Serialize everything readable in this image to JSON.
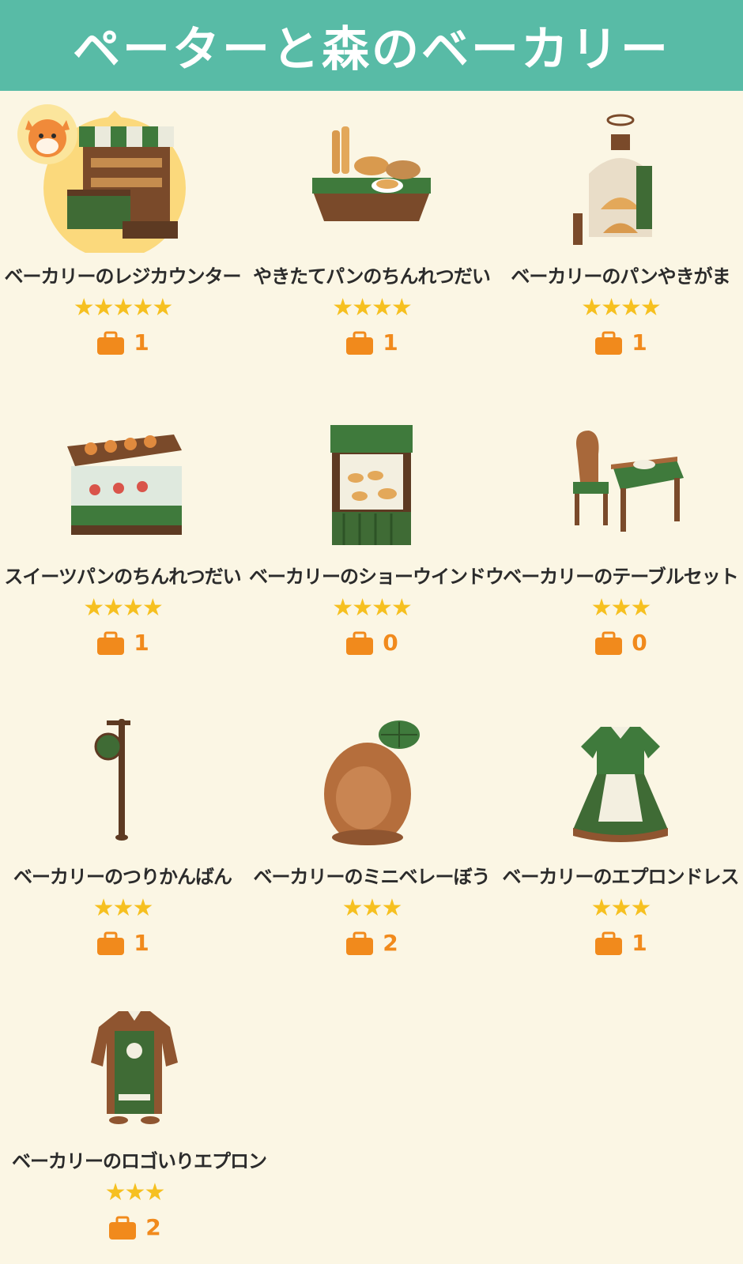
{
  "header": {
    "title": "ペーターと森のベーカリー"
  },
  "items": [
    {
      "name": "ベーカリーのレジカウンター",
      "stars": "★★★★★",
      "owned": "1",
      "icon": "bakery-register-counter"
    },
    {
      "name": "やきたてパンのちんれつだい",
      "stars": "★★★★",
      "owned": "1",
      "icon": "fresh-bread-display-table"
    },
    {
      "name": "ベーカリーのパンやきがま",
      "stars": "★★★★",
      "owned": "1",
      "icon": "bread-oven"
    },
    {
      "name": "スイーツパンのちんれつだい",
      "stars": "★★★★",
      "owned": "1",
      "icon": "sweet-bread-display-case"
    },
    {
      "name": "ベーカリーのショーウインドウ",
      "stars": "★★★★",
      "owned": "0",
      "icon": "bakery-show-window"
    },
    {
      "name": "ベーカリーのテーブルセット",
      "stars": "★★★",
      "owned": "0",
      "icon": "bakery-table-set"
    },
    {
      "name": "ベーカリーのつりかんばん",
      "stars": "★★★",
      "owned": "1",
      "icon": "hanging-sign"
    },
    {
      "name": "ベーカリーのミニベレーぼう",
      "stars": "★★★",
      "owned": "2",
      "icon": "mini-beret"
    },
    {
      "name": "ベーカリーのエプロンドレス",
      "stars": "★★★",
      "owned": "1",
      "icon": "apron-dress"
    },
    {
      "name": "ベーカリーのロゴいりエプロン",
      "stars": "★★★",
      "owned": "2",
      "icon": "logo-apron"
    }
  ],
  "colors": {
    "header": "#58bba6",
    "background": "#fbf6e4",
    "star": "#f6c020",
    "owned": "#f18a1c"
  }
}
